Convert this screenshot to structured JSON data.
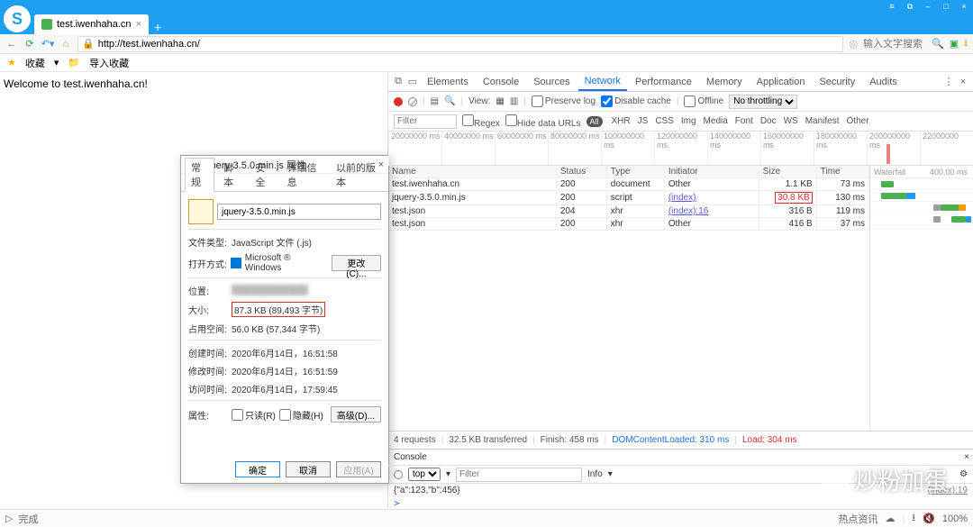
{
  "browser": {
    "tab_title": "test.iwenhaha.cn",
    "url": "http://test.iwenhaha.cn/",
    "search_placeholder": "输入文字搜索",
    "bookmarks": {
      "fav": "收藏",
      "import": "导入收藏"
    },
    "page_welcome": "Welcome to test.iwenhaha.cn!"
  },
  "devtools": {
    "tabs": {
      "elements": "Elements",
      "console": "Console",
      "sources": "Sources",
      "network": "Network",
      "performance": "Performance",
      "memory": "Memory",
      "application": "Application",
      "security": "Security",
      "audits": "Audits"
    },
    "toolbar": {
      "view": "View:",
      "preserve": "Preserve log",
      "disablecache": "Disable cache",
      "offline": "Offline",
      "throttle": "No throttling"
    },
    "filterbar": {
      "placeholder": "Filter",
      "regex": "Regex",
      "hide": "Hide data URLs",
      "all": "All",
      "types": [
        "XHR",
        "JS",
        "CSS",
        "Img",
        "Media",
        "Font",
        "Doc",
        "WS",
        "Manifest",
        "Other"
      ]
    },
    "timeline_ticks": [
      "20000000 ms",
      "40000000 ms",
      "60000000 ms",
      "80000000 ms",
      "100000000 ms",
      "120000000 ms",
      "140000000 ms",
      "160000000 ms",
      "180000000 ms",
      "200000000 ms",
      "22000000"
    ],
    "headers": {
      "name": "Name",
      "status": "Status",
      "type": "Type",
      "initiator": "Initiator",
      "size": "Size",
      "time": "Time",
      "waterfall": "Waterfall",
      "wf_scale": "400.00 ms"
    },
    "rows": [
      {
        "name": "test.iwenhaha.cn",
        "status": "200",
        "type": "document",
        "initiator": "Other",
        "initiator_link": false,
        "size": "1.1 KB",
        "size_hl": false,
        "time": "73 ms"
      },
      {
        "name": "jquery-3.5.0.min.js",
        "status": "200",
        "type": "script",
        "initiator": "(index)",
        "initiator_link": true,
        "size": "30.8 KB",
        "size_hl": true,
        "time": "130 ms"
      },
      {
        "name": "test.json",
        "status": "204",
        "type": "xhr",
        "initiator": "(index):16",
        "initiator_link": true,
        "size": "316 B",
        "size_hl": false,
        "time": "119 ms"
      },
      {
        "name": "test.json",
        "status": "200",
        "type": "xhr",
        "initiator": "Other",
        "initiator_link": false,
        "size": "416 B",
        "size_hl": false,
        "time": "37 ms"
      }
    ],
    "status": {
      "reqs": "4 requests",
      "xfer": "32.5 KB transferred",
      "finish": "Finish: 458 ms",
      "dom": "DOMContentLoaded: 310 ms",
      "load": "Load: 304 ms"
    },
    "console": {
      "tab": "Console",
      "context": "top",
      "filter_placeholder": "Filter",
      "level": "Info",
      "log": "{\"a\":123,\"b\":456}",
      "src": "(index):19",
      "prompt": ">"
    }
  },
  "dialog": {
    "title": "jquery-3.5.0.min.js 属性",
    "tabs": {
      "general": "常规",
      "script": "脚本",
      "security": "安全",
      "details": "详细信息",
      "prev": "以前的版本"
    },
    "filename": "jquery-3.5.0.min.js",
    "labels": {
      "filetype": "文件类型:",
      "openwith": "打开方式:",
      "location": "位置:",
      "size": "大小:",
      "ondisk": "占用空间:",
      "created": "创建时间:",
      "modified": "修改时间:",
      "accessed": "访问时间:",
      "attrs": "属性:"
    },
    "values": {
      "filetype": "JavaScript 文件 (.js)",
      "openwith": "Microsoft ® Windows",
      "change_btn": "更改(C)...",
      "location": "████████████",
      "size": "87.3 KB (89,493 字节)",
      "ondisk": "56.0 KB (57,344 字节)",
      "created": "2020年6月14日，16:51:58",
      "modified": "2020年6月14日，16:51:59",
      "accessed": "2020年6月14日，17:59:45"
    },
    "checks": {
      "readonly": "只读(R)",
      "hidden": "隐藏(H)"
    },
    "advanced_btn": "高级(D)...",
    "buttons": {
      "ok": "确定",
      "cancel": "取消",
      "apply": "应用(A)"
    }
  },
  "statusbar": {
    "done": "完成",
    "hot": "热点资讯",
    "zoom": "100%"
  },
  "watermark": "炒粉加蛋"
}
